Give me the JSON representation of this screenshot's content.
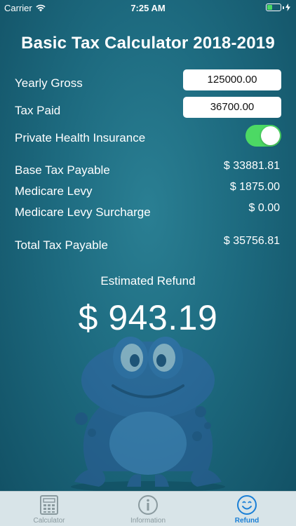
{
  "status_bar": {
    "carrier": "Carrier",
    "time": "7:25 AM"
  },
  "title": "Basic Tax Calculator 2018-2019",
  "inputs": {
    "yearly_gross": {
      "label": "Yearly Gross",
      "value": "125000.00"
    },
    "tax_paid": {
      "label": "Tax Paid",
      "value": "36700.00"
    }
  },
  "private_health": {
    "label": "Private Health Insurance",
    "enabled": true
  },
  "results": {
    "base_tax": {
      "label": "Base Tax Payable",
      "value": "$ 33881.81"
    },
    "medicare_levy": {
      "label": "Medicare Levy",
      "value": "$ 1875.00"
    },
    "medicare_surcharge": {
      "label": "Medicare Levy Surcharge",
      "value": "$ 0.00"
    },
    "total_tax": {
      "label": "Total Tax Payable",
      "value": "$ 35756.81"
    }
  },
  "refund": {
    "label": "Estimated Refund",
    "amount": "$ 943.19"
  },
  "tabbar": {
    "tabs": [
      {
        "label": "Calculator",
        "icon": "calculator-icon",
        "active": false
      },
      {
        "label": "Information",
        "icon": "info-icon",
        "active": false
      },
      {
        "label": "Refund",
        "icon": "smiley-icon",
        "active": true
      }
    ]
  },
  "colors": {
    "background": "#1d6a7f",
    "toggle_on": "#4cd964",
    "tab_active": "#1a7fd6",
    "tab_inactive": "#8a9a9f",
    "tabbar_bg": "#d8e4e8"
  }
}
